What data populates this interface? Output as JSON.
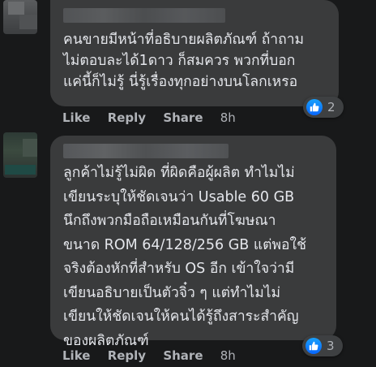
{
  "comments": [
    {
      "text_lines": [
        "คนขายมีหน้าที่อธิบายผลิตภัณฑ์ ถ้าถาม",
        "ไม่ตอบละได้1ดาว ก็สมควร พวกที่บอก",
        "แค่นี้ก็ไม่รู้ นี่รู้เรื่องทุกอย่างบนโลกเหรอ"
      ],
      "actions": {
        "like": "Like",
        "reply": "Reply",
        "share": "Share",
        "time": "8h"
      },
      "reaction": {
        "icon": "like-icon",
        "count": "2"
      }
    },
    {
      "text_lines": [
        "ลูกค้าไม่รู้ไม่ผิด ที่ผิดคือผู้ผลิต ทำไมไม่",
        "เขียนระบุให้ชัดเจนว่า Usable 60 GB",
        "นึกถึงพวกมือถือเหมือนกันที่โฆษณา",
        "ขนาด ROM 64/128/256 GB แต่พอใช้",
        "จริงต้องหักที่สำหรับ OS อีก เข้าใจว่ามี",
        "เขียนอธิบายเป็นตัวจิ๋ว ๆ แต่ทำไมไม่",
        "เขียนให้ชัดเจนให้คนได้รู้ถึงสาระสำคัญ",
        "ของผลิตภัณฑ์"
      ],
      "actions": {
        "like": "Like",
        "reply": "Reply",
        "share": "Share",
        "time": "8h"
      },
      "reaction": {
        "icon": "like-icon",
        "count": "3"
      }
    }
  ],
  "colors": {
    "background": "#18191a",
    "bubble": "#3a3b3c",
    "text": "#e4e6eb",
    "secondary_text": "#b0b3b8",
    "like_blue": "#0866ff"
  }
}
